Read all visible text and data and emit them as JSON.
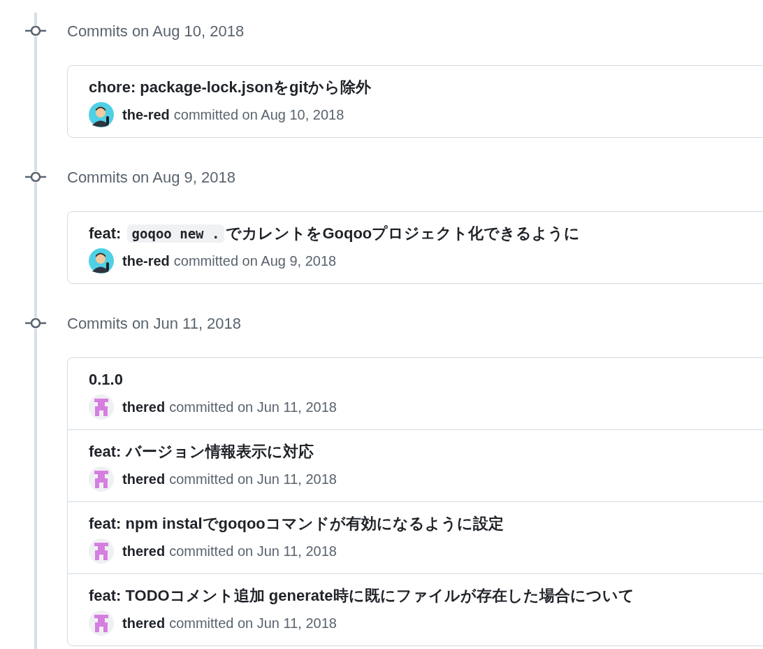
{
  "groups": [
    {
      "heading": "Commits on Aug 10, 2018",
      "commits": [
        {
          "title": [
            {
              "kind": "text",
              "text": "chore: package-lock.jsonをgitから除外"
            }
          ],
          "avatar": {
            "kind": "photo"
          },
          "author": "the-red",
          "meta": "committed on Aug 10, 2018"
        }
      ]
    },
    {
      "heading": "Commits on Aug 9, 2018",
      "commits": [
        {
          "title": [
            {
              "kind": "text",
              "text": "feat: "
            },
            {
              "kind": "code",
              "text": "goqoo new ."
            },
            {
              "kind": "text",
              "text": "でカレントをGoqooプロジェクト化できるように"
            }
          ],
          "avatar": {
            "kind": "photo"
          },
          "author": "the-red",
          "meta": "committed on Aug 9, 2018"
        }
      ]
    },
    {
      "heading": "Commits on Jun 11, 2018",
      "commits": [
        {
          "title": [
            {
              "kind": "text",
              "text": "0.1.0"
            }
          ],
          "avatar": {
            "kind": "identicon"
          },
          "author": "thered",
          "meta": "committed on Jun 11, 2018"
        },
        {
          "title": [
            {
              "kind": "text",
              "text": "feat: バージョン情報表示に対応"
            }
          ],
          "avatar": {
            "kind": "identicon"
          },
          "author": "thered",
          "meta": "committed on Jun 11, 2018"
        },
        {
          "title": [
            {
              "kind": "text",
              "text": "feat: npm instalでgoqooコマンドが有効になるように設定"
            }
          ],
          "avatar": {
            "kind": "identicon"
          },
          "author": "thered",
          "meta": "committed on Jun 11, 2018"
        },
        {
          "title": [
            {
              "kind": "text",
              "text": "feat: TODOコメント追加 generate時に既にファイルが存在した場合について"
            }
          ],
          "avatar": {
            "kind": "identicon"
          },
          "author": "thered",
          "meta": "committed on Jun 11, 2018"
        }
      ]
    }
  ]
}
